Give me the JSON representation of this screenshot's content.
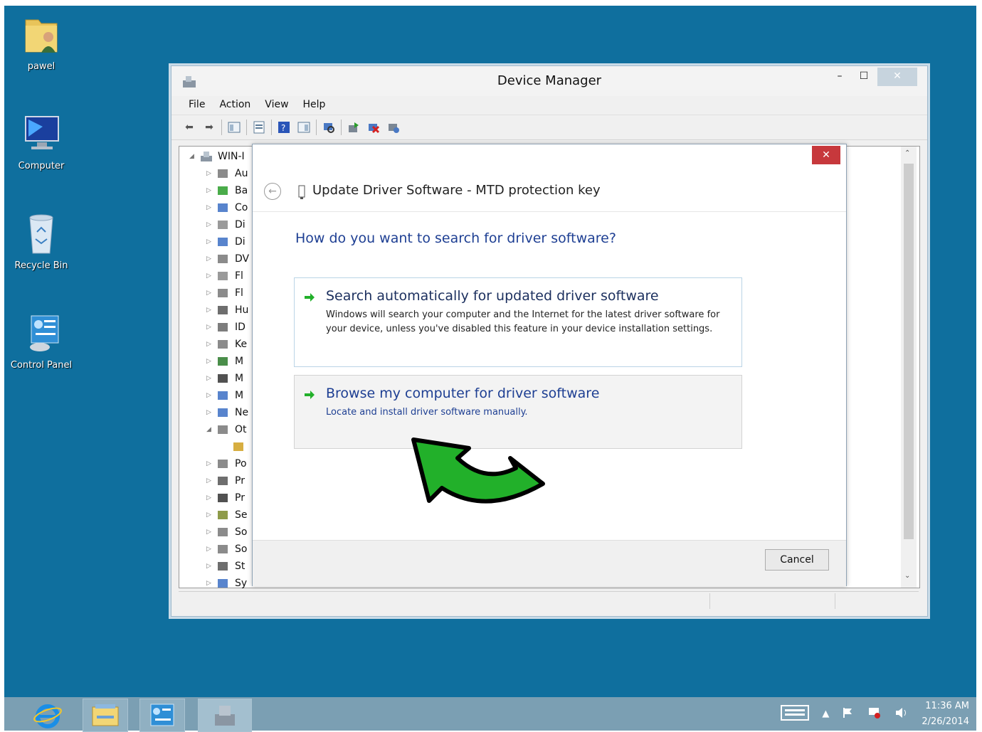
{
  "desktop": {
    "icons": [
      {
        "label": "pawel",
        "icon": "user-folder-icon"
      },
      {
        "label": "Computer",
        "icon": "computer-icon"
      },
      {
        "label": "Recycle Bin",
        "icon": "recycle-bin-icon"
      },
      {
        "label": "Control Panel",
        "icon": "control-panel-icon"
      }
    ],
    "background": "#0f6f9e"
  },
  "window": {
    "title": "Device Manager",
    "controls": {
      "minimize": "–",
      "maximize": "☐",
      "close": "✕"
    },
    "menu": [
      "File",
      "Action",
      "View",
      "Help"
    ],
    "tree": {
      "root": "WIN-I",
      "items": [
        "Au",
        "Ba",
        "Co",
        "Di",
        "Di",
        "DV",
        "Fl",
        "Fl",
        "Hu",
        "ID",
        "Ke",
        "M",
        "M",
        "M",
        "Ne",
        "Ot",
        "",
        "Po",
        "Pr",
        "Pr",
        "Se",
        "So",
        "So",
        "St",
        "Sy"
      ]
    }
  },
  "dialog": {
    "title": "Update Driver Software - MTD protection key",
    "close": "✕",
    "question": "How do you want to search for driver software?",
    "options": [
      {
        "title": "Search automatically for updated driver software",
        "description": "Windows will search your computer and the Internet for the latest driver software for your device, unless you've disabled this feature in your device installation settings."
      },
      {
        "title": "Browse my computer for driver software",
        "description": "Locate and install driver software manually."
      }
    ],
    "cancel": "Cancel"
  },
  "taskbar": {
    "clock_time": "11:36 AM",
    "clock_date": "2/26/2014"
  },
  "colors": {
    "accent_link": "#1e3f93",
    "close_red": "#c7383c",
    "arrow_green": "#22b02a"
  }
}
